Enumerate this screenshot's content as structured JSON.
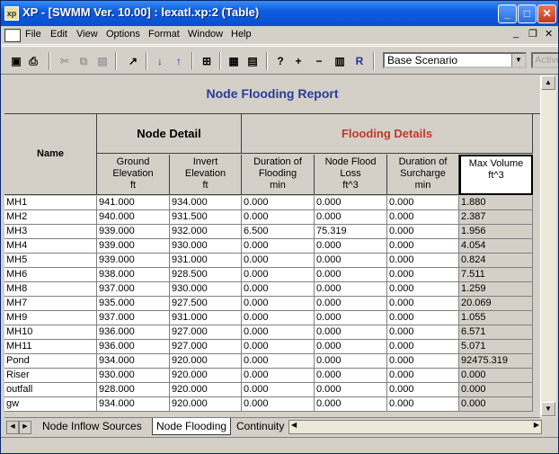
{
  "window": {
    "title": "XP - [SWMM Ver. 10.00] : lexatl.xp:2 (Table)",
    "controls": {
      "minimize": "_",
      "maximize": "□",
      "close": "✕"
    }
  },
  "menu": {
    "items": [
      "File",
      "Edit",
      "View",
      "Options",
      "Format",
      "Window",
      "Help"
    ],
    "mdi_controls": {
      "minimize": "_",
      "restore": "❐",
      "close": "✕"
    }
  },
  "toolbar": {
    "scenario_value": "Base Scenario",
    "active_field": "Active"
  },
  "report": {
    "title": "Node Flooding Report",
    "name_header": "Name",
    "group_node_detail": "Node Detail",
    "group_flooding": "Flooding Details",
    "flooding_color": "#c0392b",
    "title_color": "#2b3b9a",
    "columns": [
      {
        "line1": "Ground",
        "line2": "Elevation",
        "unit": "ft"
      },
      {
        "line1": "Invert",
        "line2": "Elevation",
        "unit": "ft"
      },
      {
        "line1": "Duration of",
        "line2": "Flooding",
        "unit": "min"
      },
      {
        "line1": "Node Flood",
        "line2": "Loss",
        "unit": "ft^3"
      },
      {
        "line1": "Duration of",
        "line2": "Surcharge",
        "unit": "min"
      },
      {
        "line1": "Max Volume",
        "line2": "ft^3",
        "unit": ""
      }
    ],
    "rows": [
      {
        "name": "MH1",
        "vals": [
          "941.000",
          "934.000",
          "0.000",
          "0.000",
          "0.000",
          "1.880"
        ]
      },
      {
        "name": "MH2",
        "vals": [
          "940.000",
          "931.500",
          "0.000",
          "0.000",
          "0.000",
          "2.387"
        ]
      },
      {
        "name": "MH3",
        "vals": [
          "939.000",
          "932.000",
          "6.500",
          "75.319",
          "0.000",
          "1.956"
        ]
      },
      {
        "name": "MH4",
        "vals": [
          "939.000",
          "930.000",
          "0.000",
          "0.000",
          "0.000",
          "4.054"
        ]
      },
      {
        "name": "MH5",
        "vals": [
          "939.000",
          "931.000",
          "0.000",
          "0.000",
          "0.000",
          "0.824"
        ]
      },
      {
        "name": "MH6",
        "vals": [
          "938.000",
          "928.500",
          "0.000",
          "0.000",
          "0.000",
          "7.511"
        ]
      },
      {
        "name": "MH8",
        "vals": [
          "937.000",
          "930.000",
          "0.000",
          "0.000",
          "0.000",
          "1.259"
        ]
      },
      {
        "name": "MH7",
        "vals": [
          "935.000",
          "927.500",
          "0.000",
          "0.000",
          "0.000",
          "20.069"
        ]
      },
      {
        "name": "MH9",
        "vals": [
          "937.000",
          "931.000",
          "0.000",
          "0.000",
          "0.000",
          "1.055"
        ]
      },
      {
        "name": "MH10",
        "vals": [
          "936.000",
          "927.000",
          "0.000",
          "0.000",
          "0.000",
          "6.571"
        ]
      },
      {
        "name": "MH11",
        "vals": [
          "936.000",
          "927.000",
          "0.000",
          "0.000",
          "0.000",
          "5.071"
        ]
      },
      {
        "name": "Pond",
        "vals": [
          "934.000",
          "920.000",
          "0.000",
          "0.000",
          "0.000",
          "92475.319"
        ]
      },
      {
        "name": "Riser",
        "vals": [
          "930.000",
          "920.000",
          "0.000",
          "0.000",
          "0.000",
          "0.000"
        ]
      },
      {
        "name": "outfall",
        "vals": [
          "928.000",
          "920.000",
          "0.000",
          "0.000",
          "0.000",
          "0.000"
        ]
      },
      {
        "name": "gw",
        "vals": [
          "934.000",
          "920.000",
          "0.000",
          "0.000",
          "0.000",
          "0.000"
        ]
      }
    ]
  },
  "tabs": [
    "Node Inflow Sources",
    "Node Flooding",
    "Continuity"
  ],
  "active_tab": "Node Flooding"
}
